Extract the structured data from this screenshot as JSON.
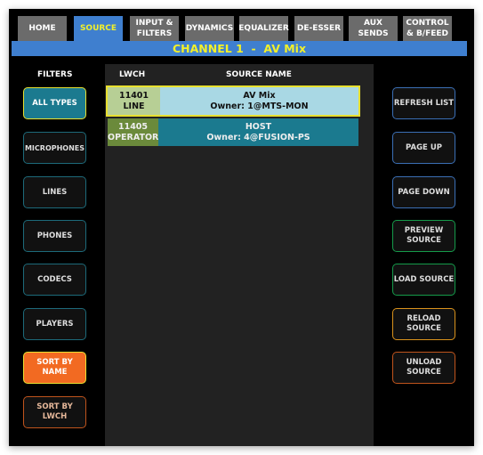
{
  "tabs": [
    {
      "label": "HOME"
    },
    {
      "label": "SOURCE",
      "active": true
    },
    {
      "label": "INPUT & FILTERS"
    },
    {
      "label": "DYNAMICS"
    },
    {
      "label": "EQUALIZER"
    },
    {
      "label": "DE-ESSER"
    },
    {
      "label": "AUX SENDS"
    },
    {
      "label": "CONTROL & B/FEED"
    }
  ],
  "channel_title": "CHANNEL 1  -  AV Mix",
  "filters_label": "FILTERS",
  "columns": {
    "lwch": "LWCH",
    "source_name": "SOURCE NAME"
  },
  "rows": [
    {
      "lwch": "11401",
      "type": "LINE",
      "name": "AV Mix",
      "owner": "Owner: 1@MTS-MON",
      "selected": true
    },
    {
      "lwch": "11405",
      "type": "OPERATOR",
      "name": "HOST",
      "owner": "Owner: 4@FUSION-PS",
      "selected": false
    }
  ],
  "filters": [
    {
      "label": "ALL TYPES",
      "active": true
    },
    {
      "label": "MICROPHONES"
    },
    {
      "label": "LINES"
    },
    {
      "label": "PHONES"
    },
    {
      "label": "CODECS"
    },
    {
      "label": "PLAYERS"
    },
    {
      "label": "SORT BY NAME",
      "active": true
    },
    {
      "label": "SORT BY LWCH"
    }
  ],
  "actions": [
    {
      "label": "REFRESH LIST"
    },
    {
      "label": "PAGE UP"
    },
    {
      "label": "PAGE DOWN"
    },
    {
      "label": "PREVIEW SOURCE"
    },
    {
      "label": "LOAD SOURCE"
    },
    {
      "label": "RELOAD SOURCE"
    },
    {
      "label": "UNLOAD SOURCE"
    }
  ],
  "colors": {
    "accent_blue": "#3f7fcf",
    "highlight_yellow": "#f2f02a",
    "teal": "#1b7a8f",
    "sort_orange": "#f26a22"
  }
}
